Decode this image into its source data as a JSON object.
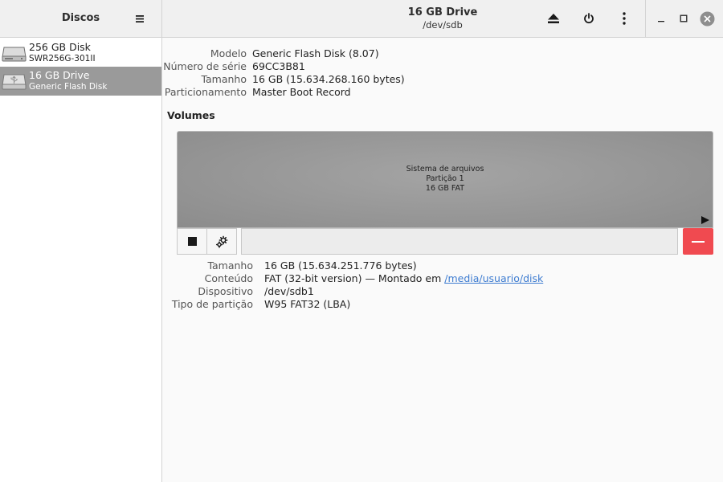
{
  "sidebar": {
    "title": "Discos",
    "disks": [
      {
        "name": "256 GB Disk",
        "sub": "SWR256G-301II",
        "icon": "hard-disk-icon"
      },
      {
        "name": "16 GB Drive",
        "sub": "Generic Flash Disk",
        "icon": "usb-drive-icon"
      }
    ]
  },
  "header": {
    "title": "16 GB Drive",
    "subtitle": "/dev/sdb"
  },
  "drive": {
    "model_label": "Modelo",
    "model": "Generic Flash Disk (8.07)",
    "serial_label": "Número de série",
    "serial": "69CC3B81",
    "size_label": "Tamanho",
    "size": "16 GB (15.634.268.160 bytes)",
    "partitioning_label": "Particionamento",
    "partitioning": "Master Boot Record"
  },
  "volumes": {
    "title": "Volumes",
    "partition": {
      "line1": "Sistema de arquivos",
      "line2": "Partição 1",
      "line3": "16 GB FAT"
    }
  },
  "volume_details": {
    "size_label": "Tamanho",
    "size": "16 GB (15.634.251.776 bytes)",
    "content_label": "Conteúdo",
    "content_prefix": "FAT (32-bit version) — Montado em ",
    "mount_link": "/media/usuario/disk",
    "device_label": "Dispositivo",
    "device": "/dev/sdb1",
    "type_label": "Tipo de partição",
    "type": "W95 FAT32 (LBA)"
  },
  "colors": {
    "selected_row": "#9a9a9a",
    "delete_button": "#f04a50",
    "link": "#3c7bd0"
  }
}
